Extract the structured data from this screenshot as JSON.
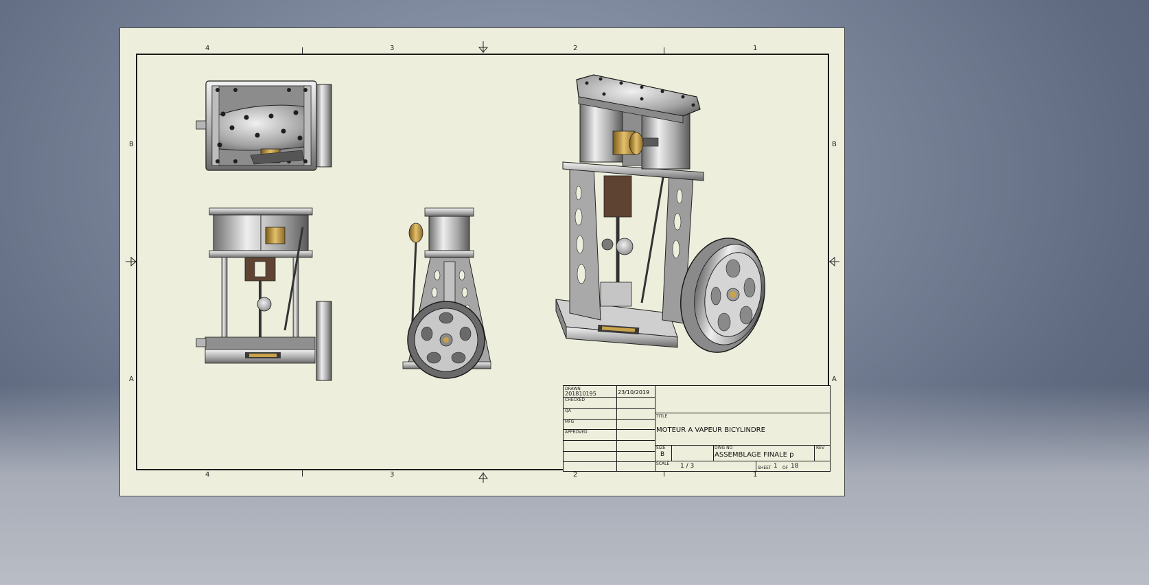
{
  "zones": {
    "columns": [
      "4",
      "3",
      "2",
      "1"
    ],
    "rows": [
      "B",
      "A"
    ]
  },
  "title_block": {
    "drawn_label": "DRAWN",
    "drawn_by": "201810195",
    "drawn_date": "23/10/2019",
    "checked_label": "CHECKED",
    "qa_label": "QA",
    "mfg_label": "MFG",
    "approved_label": "APPROVED",
    "title_label": "TITLE",
    "title": "MOTEUR A VAPEUR BICYLINDRE",
    "size_label": "SIZE",
    "size": "B",
    "dwg_no_label": "DWG NO",
    "dwg_no": "ASSEMBLAGE FINALE p",
    "rev_label": "REV",
    "scale_label": "SCALE",
    "scale": "1 / 3",
    "sheet_label": "SHEET",
    "sheet_no": "1",
    "sheet_of": "OF",
    "sheet_total": "18"
  },
  "colors": {
    "sheet": "#edeedc",
    "metal_light": "#d9d9d9",
    "metal_dark": "#555555",
    "brass": "#c9a24a",
    "bronze": "#6b4a35"
  },
  "views": [
    "top-view",
    "front-view",
    "side-view",
    "isometric-view"
  ]
}
